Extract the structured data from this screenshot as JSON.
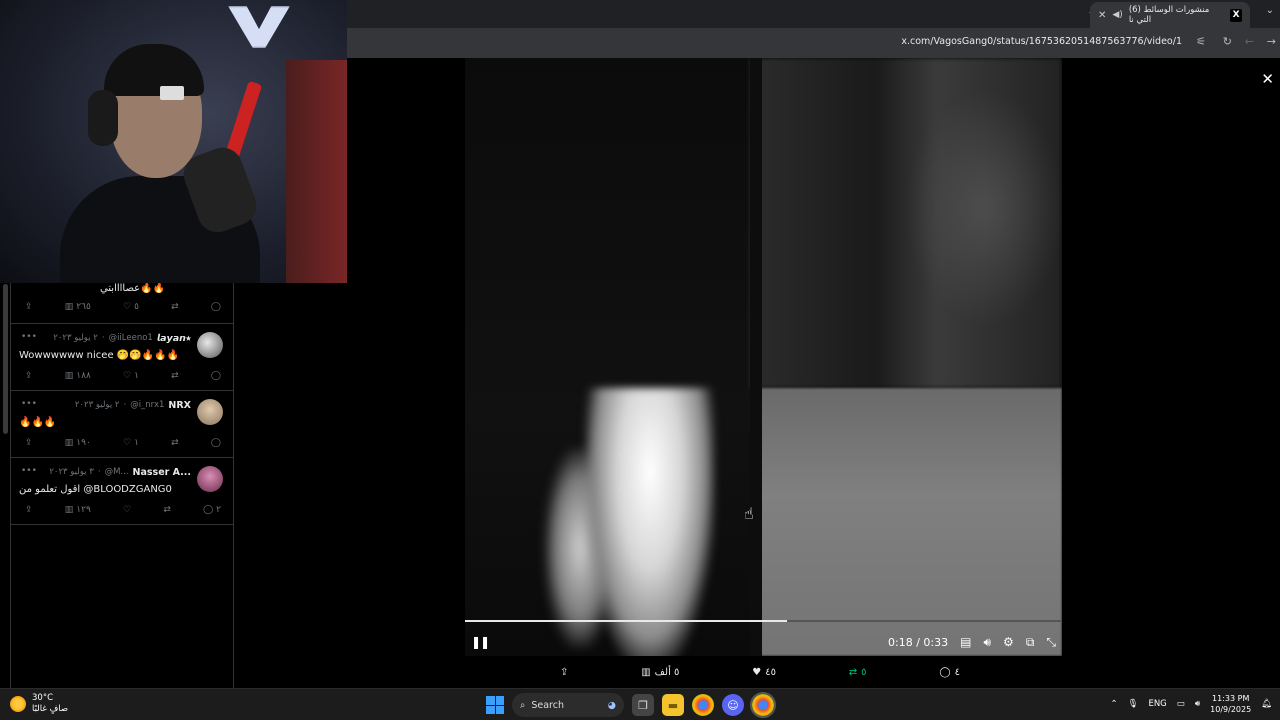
{
  "browser": {
    "tab_title": "(6) منشورات الوسائط التي نا",
    "tab_logo": "X",
    "new_tab": "+",
    "url": "x.com/VagosGang0/status/1675362051487563776/video/1"
  },
  "timeline": {
    "top_tweet": {
      "text": "عصاااابتي🔥🔥",
      "views": "٢٦٥",
      "likes": "٥"
    },
    "tweets": [
      {
        "name": "𝙡𝙖𝙮𝙖𝙣⭑",
        "handle": "@iiLeeno1",
        "date": "٢ يوليو ٢٠٢٣",
        "text": "Wowwwwww nicee 🤭🤭🔥🔥🔥",
        "views": "١٨٨",
        "likes": "١",
        "replies": "",
        "avatar_color": "#cfcfcf"
      },
      {
        "name": "NRX",
        "handle": "@i_nrx1",
        "date": "٢ يوليو ٢٠٢٣",
        "text": "🔥🔥🔥",
        "views": "١٩٠",
        "likes": "١",
        "replies": "",
        "avatar_color": "#b9a58f"
      },
      {
        "name": "Nasser A...",
        "handle": "@M...",
        "date": "٣ يوليو ٢٠٢٣",
        "text": "اقول تعلمو من @BLOODZGANG0",
        "views": "١٢٩",
        "likes": "",
        "replies": "٢",
        "avatar_color": "#b45f8a"
      }
    ]
  },
  "video": {
    "time": "0:18 / 0:33",
    "progress": 0.54
  },
  "engagement": {
    "views": "٥ ألف",
    "likes": "٤٥",
    "retweets": "٥",
    "replies": "٤"
  },
  "taskbar": {
    "temp": "30°C",
    "weather": "صافٍ غالبًا",
    "search": "Search",
    "lang": "ENG",
    "time": "11:33 PM",
    "date": "10/9/2025"
  }
}
